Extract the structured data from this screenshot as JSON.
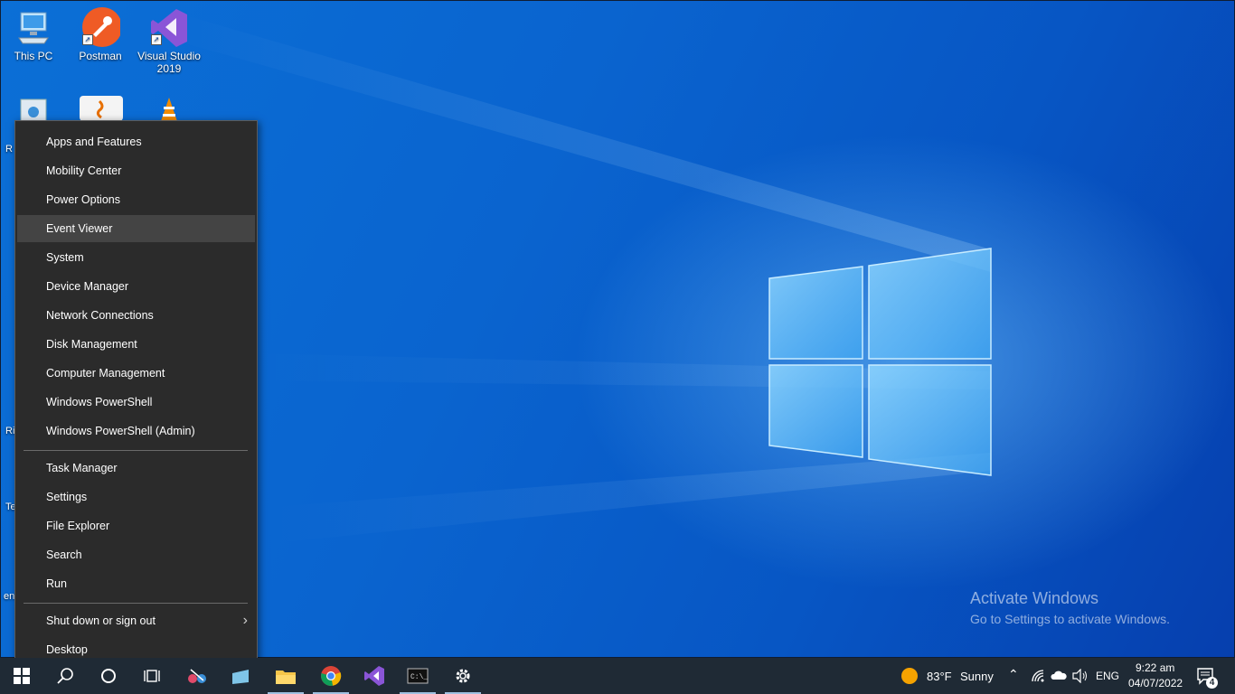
{
  "desktop": {
    "icons": [
      {
        "label": "This PC"
      },
      {
        "label": "Postman"
      },
      {
        "label": "Visual Studio 2019"
      }
    ],
    "partial_labels": [
      "R",
      "Ri",
      "Te",
      "en"
    ]
  },
  "watermark": {
    "title": "Activate Windows",
    "subtitle": "Go to Settings to activate Windows."
  },
  "context_menu": {
    "group1": [
      "Apps and Features",
      "Mobility Center",
      "Power Options",
      "Event Viewer",
      "System",
      "Device Manager",
      "Network Connections",
      "Disk Management",
      "Computer Management",
      "Windows PowerShell",
      "Windows PowerShell (Admin)"
    ],
    "group2": [
      "Task Manager",
      "Settings",
      "File Explorer",
      "Search",
      "Run"
    ],
    "group3": [
      "Shut down or sign out",
      "Desktop"
    ],
    "highlighted": "Event Viewer"
  },
  "taskbar": {
    "weather_temp": "83°F",
    "weather_desc": "Sunny",
    "language": "ENG",
    "time": "9:22 am",
    "date": "04/07/2022",
    "notification_count": "4"
  },
  "colors": {
    "menu_bg": "#2b2b2b",
    "menu_hover": "#444444",
    "taskbar_bg": "#1f2a35",
    "wallpaper_blue": "#0a64cf"
  }
}
